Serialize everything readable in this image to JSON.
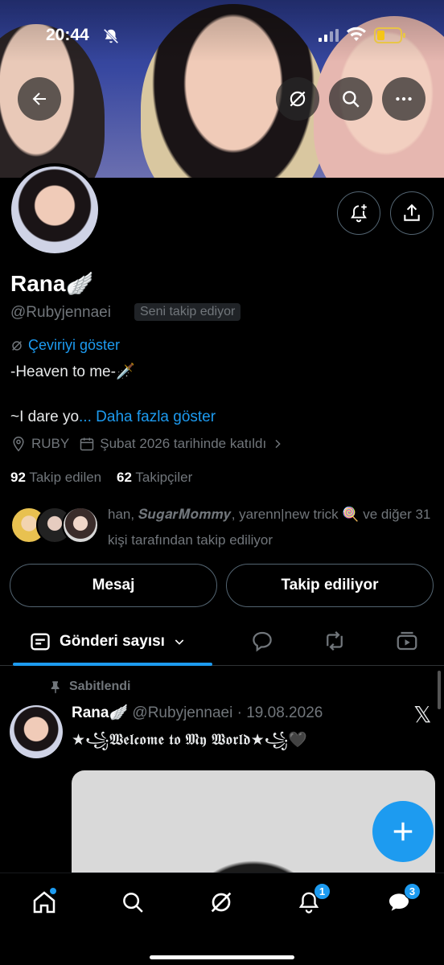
{
  "status_bar": {
    "time": "20:44"
  },
  "profile": {
    "name": "Rana",
    "name_emoji": "🪽",
    "handle": "@Rubyjennaei",
    "follows_you_badge": "Seni takip ediyor",
    "translate_link": "Çeviriyi göster",
    "bio_line1": "-Heaven to me-🗡️",
    "bio_line2": "~I dare yo",
    "bio_ellipsis": "...",
    "show_more": "Daha fazla göster",
    "location": "RUBY",
    "joined": "Şubat 2026 tarihinde katıldı",
    "following_count": "92",
    "following_label": "Takip edilen",
    "followers_count": "62",
    "followers_label": "Takipçiler",
    "followed_by": "han, 𝑺𝒖𝒈𝒂𝒓𝑴𝒐𝒎𝒎𝒚, yarenn|new trick 🍭 ve diğer 31 kişi tarafından takip ediliyor",
    "message_button": "Mesaj",
    "following_button": "Takip ediliyor"
  },
  "tabs": {
    "active_label": "Gönderi sayısı"
  },
  "post": {
    "pinned_label": "Sabitlendi",
    "author_name": "Rana",
    "author_emoji": "🪽",
    "author_handle": "@Rubyjennaei",
    "separator": "·",
    "date": "19.08.2026",
    "text": "★꧁𝖂𝖊𝖑𝖈𝖔𝖒𝖊 𝖙𝖔 𝕸𝖞 𝖂𝖔𝖗𝖑𝖉★꧁🖤",
    "x_logo": "𝕏"
  },
  "bottom_nav": {
    "notifications_badge": "1",
    "messages_badge": "3"
  },
  "colors": {
    "accent": "#1d9bf0",
    "background": "#000000",
    "muted": "#71767b"
  }
}
